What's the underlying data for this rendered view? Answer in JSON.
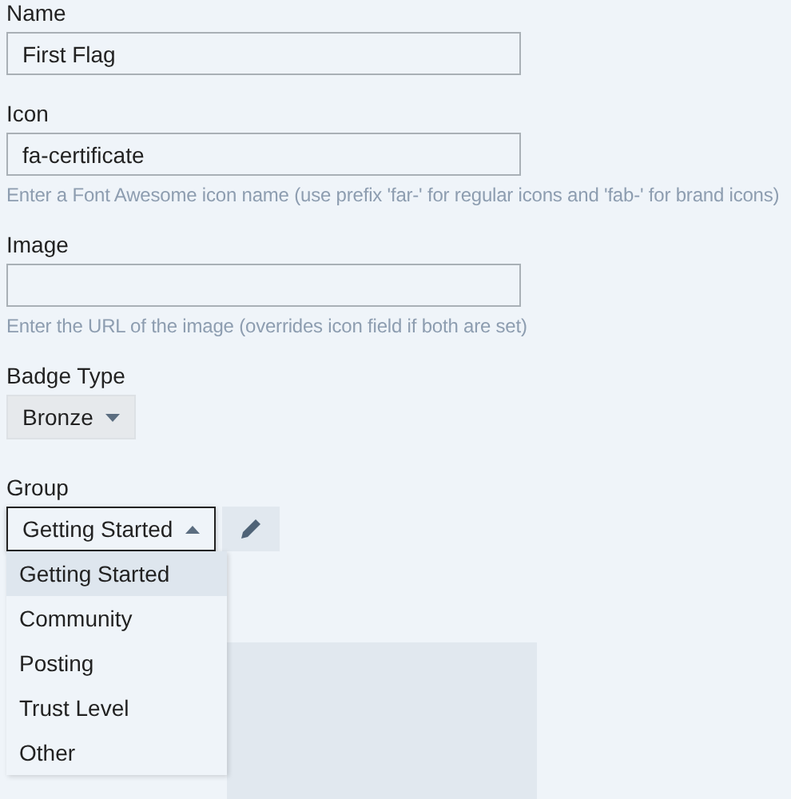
{
  "fields": [
    {
      "kind": "text",
      "label": "Name",
      "value": "First Flag"
    },
    {
      "kind": "text",
      "label": "Icon",
      "value": "fa-certificate",
      "help": "Enter a Font Awesome icon name (use prefix 'far-' for regular icons and 'fab-' for brand icons)"
    },
    {
      "kind": "text",
      "label": "Image",
      "help": "Enter the URL of the image (overrides icon field if both are set)"
    },
    {
      "kind": "dropdown",
      "label": "Badge Type",
      "value": "Bronze",
      "expanded": false
    },
    {
      "kind": "group",
      "label": "Group",
      "value": "Getting Started",
      "expanded": true,
      "options": [
        {
          "label": "Getting Started",
          "selected": true
        },
        {
          "label": "Community",
          "selected": false
        },
        {
          "label": "Posting",
          "selected": false
        },
        {
          "label": "Trust Level",
          "selected": false
        },
        {
          "label": "Other",
          "selected": false
        }
      ]
    }
  ]
}
